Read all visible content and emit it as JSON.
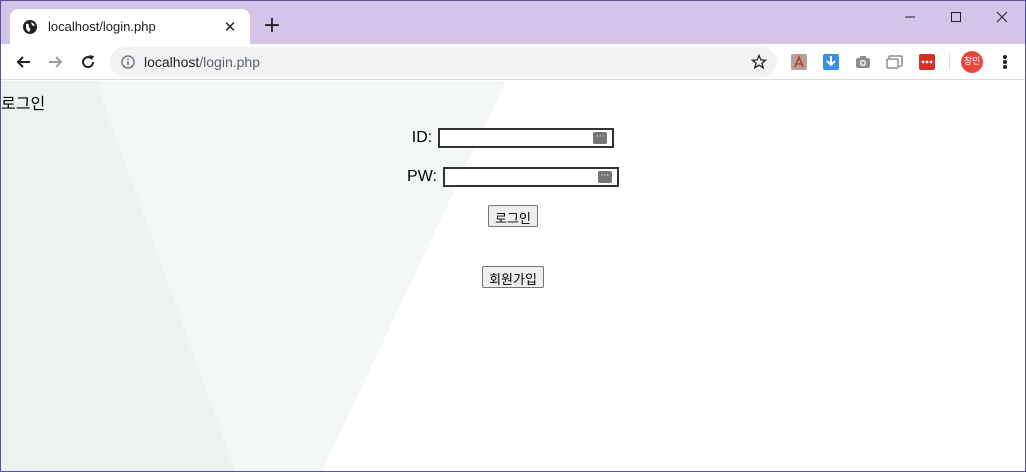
{
  "browser": {
    "tab_title": "localhost/login.php",
    "close_tab_glyph": "✕",
    "new_tab_glyph": "+",
    "url_host": "localhost",
    "url_path": "/login.php",
    "profile_initials": "창민",
    "window_controls": {
      "minimize": "—",
      "maximize": "☐",
      "close": "✕"
    },
    "colors": {
      "tabstrip": "#d2c5e8",
      "profile": "#e8453c"
    }
  },
  "page": {
    "heading": "로그인",
    "id_label": "ID:",
    "pw_label": "PW:",
    "id_value": "",
    "pw_value": "",
    "login_button": "로그인",
    "signup_button": "회원가입"
  }
}
